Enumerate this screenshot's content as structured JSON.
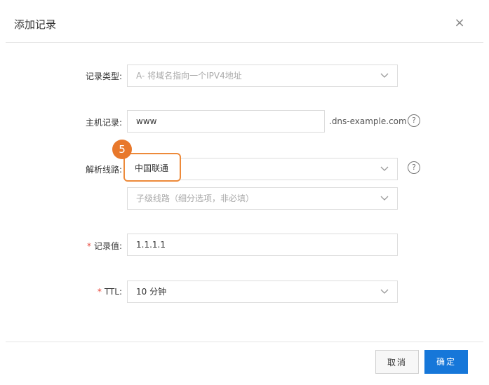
{
  "dialog": {
    "title": "添加记录",
    "close_label": "×"
  },
  "form": {
    "record_type": {
      "label": "记录类型:",
      "value": "A- 将域名指向一个IPV4地址"
    },
    "host_record": {
      "label": "主机记录:",
      "value": "www",
      "suffix": ".dns-example.com"
    },
    "line": {
      "label": "解析线路:",
      "value": "中国联通",
      "sub_placeholder": "子级线路（细分选项，非必填）",
      "step_badge": "5"
    },
    "record_value": {
      "required_mark": "*",
      "label": "记录值:",
      "value": "1.1.1.1"
    },
    "ttl": {
      "required_mark": "*",
      "label": "TTL:",
      "value": "10 分钟"
    }
  },
  "help_glyph": "?",
  "footer": {
    "cancel_label": "取消",
    "ok_label": "确定"
  },
  "colors": {
    "primary": "#1677d9",
    "highlight": "#ed8a3a",
    "required": "#e8473b"
  }
}
